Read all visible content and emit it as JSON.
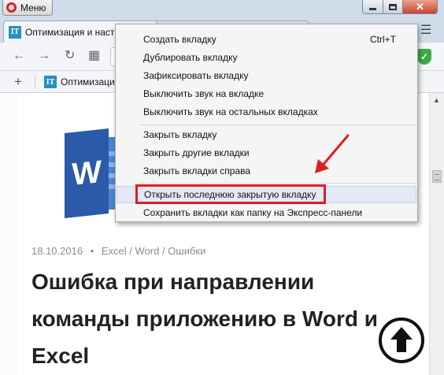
{
  "titlebar": {
    "menu_label": "Меню",
    "close_glyph": "✕"
  },
  "tabs": [
    {
      "label": "Оптимизация и настр",
      "favicon": "IT",
      "close": "×"
    },
    {
      "label": "...",
      "favicon": "grid-icon",
      "close": "×"
    }
  ],
  "navbar": {
    "back_icon": "←",
    "forward_icon": "→",
    "reload_icon": "↻",
    "speeddial_icon": "▦",
    "shield_glyph": "✓"
  },
  "bookmarks": {
    "add_glyph": "+",
    "item_label": "Оптимизаци",
    "item_favicon": "IT"
  },
  "context_menu": {
    "items": [
      {
        "label": "Создать вкладку",
        "shortcut": "Ctrl+T"
      },
      {
        "label": "Дублировать вкладку"
      },
      {
        "label": "Зафиксировать вкладку"
      },
      {
        "label": "Выключить звук на вкладке"
      },
      {
        "label": "Выключить звук на остальных вкладках"
      },
      {
        "label": "Закрыть вкладку"
      },
      {
        "label": "Закрыть другие вкладки"
      },
      {
        "label": "Закрыть вкладки справа"
      },
      {
        "label": "Открыть последнюю закрытую вкладку",
        "highlighted": true
      },
      {
        "label": "Сохранить вкладки как папку на Экспресс-панели"
      }
    ]
  },
  "article": {
    "logo_letter": "W",
    "date": "18.10.2016",
    "separator": "•",
    "categories": "Excel / Word / Ошибки",
    "title": "Ошибка при направлении команды приложению в Word и Excel"
  },
  "colors": {
    "accent_red": "#e21b23",
    "opera_red": "#e0202a",
    "word_blue": "#2a5aa8",
    "favicon_blue": "#2a8fc1"
  }
}
